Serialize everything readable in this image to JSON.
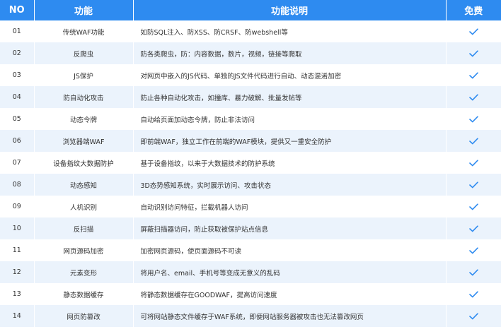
{
  "header": {
    "no": "NO",
    "function": "功能",
    "description": "功能说明",
    "free": "免费"
  },
  "accent_color": "#2e8bf0",
  "stripe_color": "#ebf3fc",
  "check_icon": "checkmark-icon",
  "rows": [
    {
      "no": "01",
      "function": "传统WAF功能",
      "description": "如防SQL注入、防XSS、防CRSF、防webshell等",
      "free": true
    },
    {
      "no": "02",
      "function": "反爬虫",
      "description": "防各类爬虫，防：内容数据，数片，视频，链接等爬取",
      "free": true
    },
    {
      "no": "03",
      "function": "JS保护",
      "description": "对网页中嵌入的JS代码、单独的JS文件代码进行自动、动态混淆加密",
      "free": true
    },
    {
      "no": "04",
      "function": "防自动化攻击",
      "description": "防止各种自动化攻击，如撞库、暴力破解、批量发帖等",
      "free": true
    },
    {
      "no": "05",
      "function": "动态令牌",
      "description": "自动给页面加动态令牌，防止非法访问",
      "free": true
    },
    {
      "no": "06",
      "function": "浏览器端WAF",
      "description": "即前端WAF，独立工作在前端的WAF模块，提供又一重安全防护",
      "free": true
    },
    {
      "no": "07",
      "function": "设备指纹大数据防护",
      "description": "基于设备指纹，以来于大数据技术的防护系统",
      "free": true
    },
    {
      "no": "08",
      "function": "动态感知",
      "description": "3D态势感知系统，实时展示访问、攻击状态",
      "free": true
    },
    {
      "no": "09",
      "function": "人机识别",
      "description": "自动识别访问特征，拦截机器人访问",
      "free": true
    },
    {
      "no": "10",
      "function": "反扫描",
      "description": "屏蔽扫描器访问，防止获取被保护站点信息",
      "free": true
    },
    {
      "no": "11",
      "function": "网页源码加密",
      "description": "加密网页源码，使页面源码不可读",
      "free": true
    },
    {
      "no": "12",
      "function": "元素变形",
      "description": "将用户名、email、手机号等变成无意义的乱码",
      "free": true
    },
    {
      "no": "13",
      "function": "静态数据缓存",
      "description": "将静态数据缓存在GOODWAF，提高访问速度",
      "free": true
    },
    {
      "no": "14",
      "function": "网页防篡改",
      "description": "可将网站静态文件缓存于WAF系统，即便网站服务器被攻击也无法篡改网页",
      "free": true
    }
  ]
}
